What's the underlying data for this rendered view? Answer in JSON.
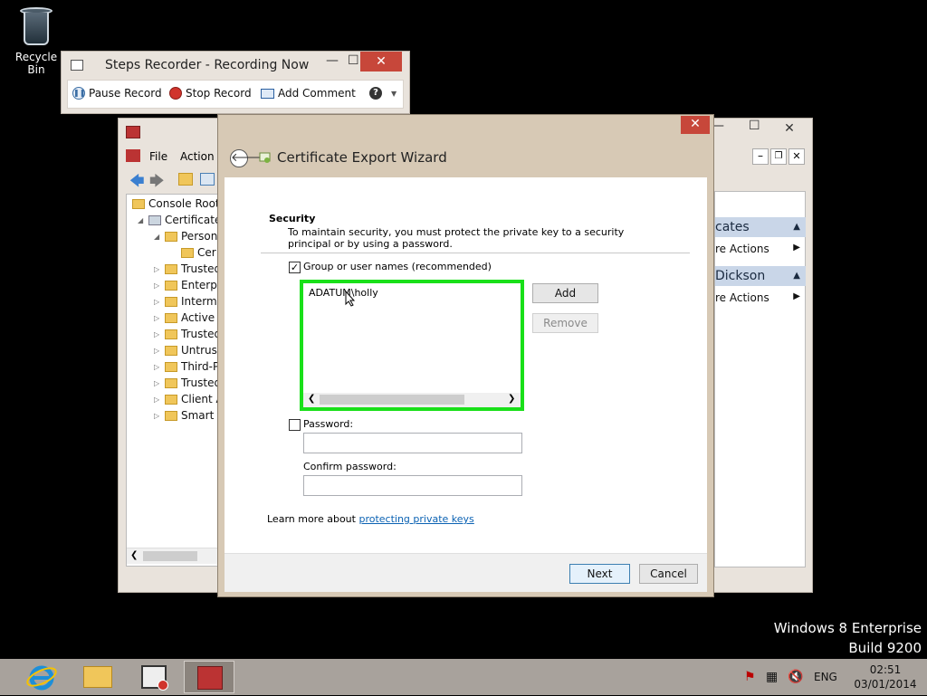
{
  "desktop": {
    "recycle_bin_label": "Recycle Bin",
    "windows_edition": "Windows 8 Enterprise",
    "build": "Build 9200"
  },
  "steps_recorder": {
    "title": "Steps Recorder - Recording Now",
    "pause_label": "Pause Record",
    "stop_label": "Stop Record",
    "add_comment_label": "Add Comment",
    "help_icon": "?"
  },
  "mmc": {
    "menu": {
      "file": "File",
      "action": "Action"
    },
    "tree": [
      {
        "label": "Console Root"
      },
      {
        "label": "Certificates"
      },
      {
        "label": "Persona"
      },
      {
        "label": "Cer"
      },
      {
        "label": "Trusted"
      },
      {
        "label": "Enterpr"
      },
      {
        "label": "Interme"
      },
      {
        "label": "Active I"
      },
      {
        "label": "Trusted"
      },
      {
        "label": "Untrust"
      },
      {
        "label": "Third-P"
      },
      {
        "label": "Trusted"
      },
      {
        "label": "Client A"
      },
      {
        "label": "Smart C"
      }
    ],
    "actions": {
      "section1_title": "cates",
      "section1_item": "re Actions",
      "section2_title": "Dickson",
      "section2_item": "re Actions"
    }
  },
  "wizard": {
    "title": "Certificate Export Wizard",
    "section_heading": "Security",
    "section_desc": "To maintain security, you must protect the private key to a security principal or by using a password.",
    "group_checkbox_label": "Group or user names (recommended)",
    "group_checked": true,
    "principals": [
      "ADATUM\\holly"
    ],
    "add_label": "Add",
    "remove_label": "Remove",
    "password_checkbox_label": "Password:",
    "password_checked": false,
    "confirm_password_label": "Confirm password:",
    "learn_more_prefix": "Learn more about ",
    "learn_more_link": "protecting private keys",
    "next_label": "Next",
    "cancel_label": "Cancel"
  },
  "taskbar": {
    "language": "ENG",
    "time": "02:51",
    "date": "03/01/2014"
  },
  "colors": {
    "highlight_green": "#19e019",
    "close_red": "#c7473a",
    "taskbar": "#a8a29c"
  }
}
